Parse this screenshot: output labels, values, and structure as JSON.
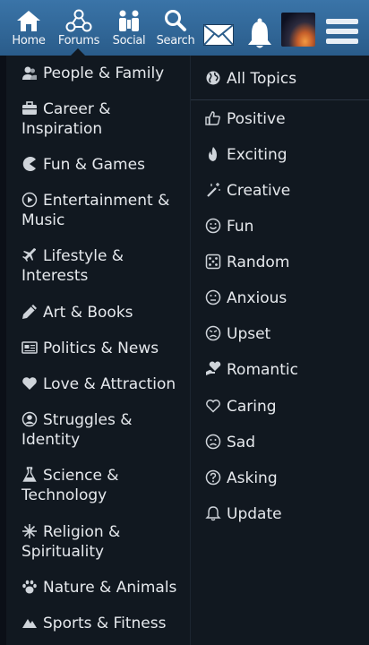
{
  "nav": {
    "home": "Home",
    "forums": "Forums",
    "social": "Social",
    "search": "Search"
  },
  "categories": [
    {
      "label": "People & Family",
      "icon": "people-icon"
    },
    {
      "label": "Career & Inspiration",
      "icon": "briefcase-icon"
    },
    {
      "label": "Fun & Games",
      "icon": "pacman-icon"
    },
    {
      "label": "Entertainment & Music",
      "icon": "play-icon"
    },
    {
      "label": "Lifestyle & Interests",
      "icon": "plane-icon"
    },
    {
      "label": "Art & Books",
      "icon": "pencil-icon"
    },
    {
      "label": "Politics & News",
      "icon": "newspaper-icon"
    },
    {
      "label": "Love & Attraction",
      "icon": "heart-icon"
    },
    {
      "label": "Struggles & Identity",
      "icon": "user-circle-icon"
    },
    {
      "label": "Science & Technology",
      "icon": "flask-icon"
    },
    {
      "label": "Religion & Spirituality",
      "icon": "sparkle-icon"
    },
    {
      "label": "Nature & Animals",
      "icon": "paw-icon"
    },
    {
      "label": "Sports & Fitness",
      "icon": "mountain-icon"
    }
  ],
  "topics": [
    {
      "label": "All Topics",
      "icon": "globe-icon"
    },
    {
      "label": "Positive",
      "icon": "thumbs-up-icon"
    },
    {
      "label": "Exciting",
      "icon": "flame-icon"
    },
    {
      "label": "Creative",
      "icon": "magic-wand-icon"
    },
    {
      "label": "Fun",
      "icon": "smile-icon"
    },
    {
      "label": "Random",
      "icon": "dice-icon"
    },
    {
      "label": "Anxious",
      "icon": "neutral-face-icon"
    },
    {
      "label": "Upset",
      "icon": "upset-face-icon"
    },
    {
      "label": "Romantic",
      "icon": "heart-hand-icon"
    },
    {
      "label": "Caring",
      "icon": "heart-outline-icon"
    },
    {
      "label": "Sad",
      "icon": "sad-face-icon"
    },
    {
      "label": "Asking",
      "icon": "question-icon"
    },
    {
      "label": "Update",
      "icon": "bell-icon"
    }
  ],
  "colors": {
    "header": "#2f6594",
    "panel": "#111820",
    "text": "#e6e9ed"
  }
}
